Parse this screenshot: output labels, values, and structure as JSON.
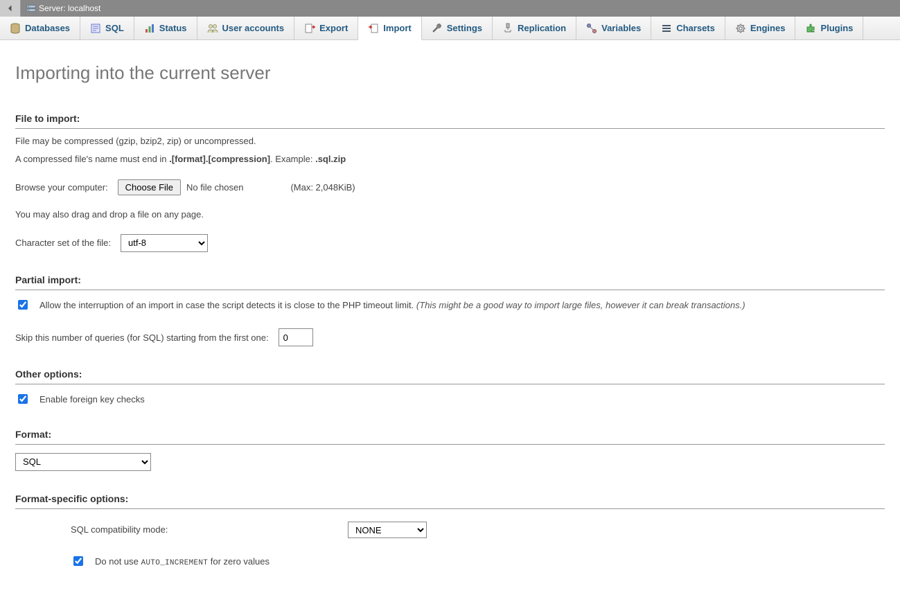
{
  "topbar": {
    "server_label": "Server: localhost"
  },
  "tabs": [
    {
      "id": "databases",
      "label": "Databases"
    },
    {
      "id": "sql",
      "label": "SQL"
    },
    {
      "id": "status",
      "label": "Status"
    },
    {
      "id": "useraccounts",
      "label": "User accounts"
    },
    {
      "id": "export",
      "label": "Export"
    },
    {
      "id": "import",
      "label": "Import",
      "active": true
    },
    {
      "id": "settings",
      "label": "Settings"
    },
    {
      "id": "replication",
      "label": "Replication"
    },
    {
      "id": "variables",
      "label": "Variables"
    },
    {
      "id": "charsets",
      "label": "Charsets"
    },
    {
      "id": "engines",
      "label": "Engines"
    },
    {
      "id": "plugins",
      "label": "Plugins"
    }
  ],
  "page": {
    "title": "Importing into the current server"
  },
  "file_section": {
    "heading": "File to import:",
    "note1": "File may be compressed (gzip, bzip2, zip) or uncompressed.",
    "note2a": "A compressed file's name must end in ",
    "note2b": ".[format].[compression]",
    "note2c": ". Example: ",
    "note2d": ".sql.zip",
    "browse_label": "Browse your computer:",
    "choose_button": "Choose File",
    "no_file": "No file chosen",
    "max": "(Max: 2,048KiB)",
    "dragdrop": "You may also drag and drop a file on any page.",
    "charset_label": "Character set of the file:",
    "charset_value": "utf-8"
  },
  "partial_section": {
    "heading": "Partial import:",
    "allow_label": "Allow the interruption of an import in case the script detects it is close to the PHP timeout limit.",
    "allow_hint": "(This might be a good way to import large files, however it can break transactions.)",
    "skip_label": "Skip this number of queries (for SQL) starting from the first one:",
    "skip_value": "0"
  },
  "other_section": {
    "heading": "Other options:",
    "fk_label": "Enable foreign key checks"
  },
  "format_section": {
    "heading": "Format:",
    "value": "SQL"
  },
  "fso_section": {
    "heading": "Format-specific options:",
    "compat_label": "SQL compatibility mode:",
    "compat_value": "NONE",
    "autoinc_pre": "Do not use ",
    "autoinc_code": "AUTO_INCREMENT",
    "autoinc_post": " for zero values"
  }
}
